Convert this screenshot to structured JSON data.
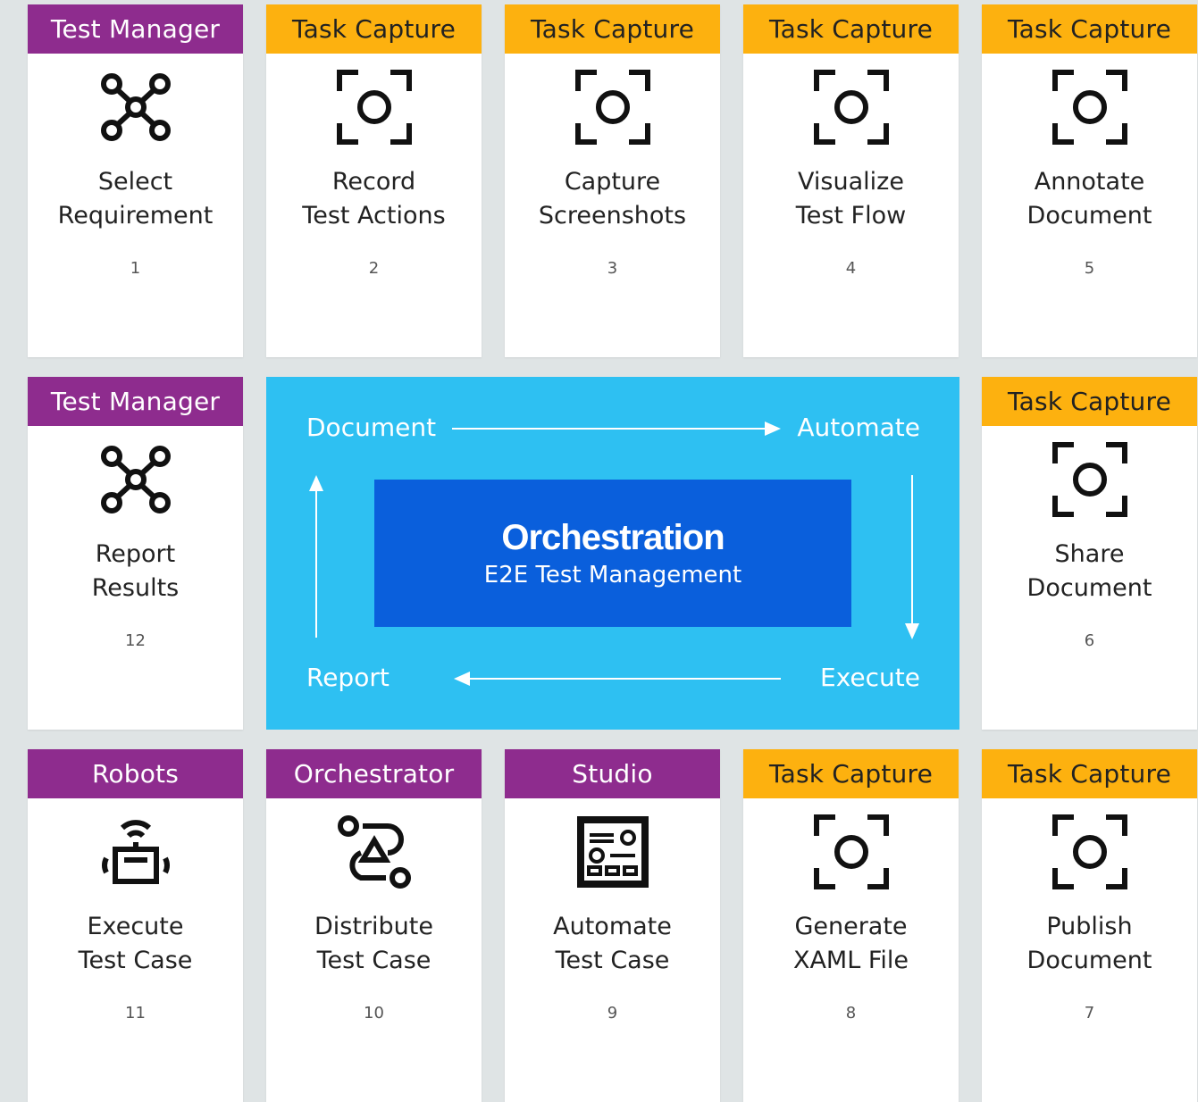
{
  "cards": [
    {
      "id": "select-requirement",
      "header": "Test Manager",
      "header_color": "#8e2c8e",
      "icon": "nodes-icon",
      "title": [
        "Select",
        "Requirement"
      ],
      "number": "1"
    },
    {
      "id": "record-test-actions",
      "header": "Task Capture",
      "header_color": "#fdb10f",
      "icon": "capture-icon",
      "title": [
        "Record",
        "Test Actions"
      ],
      "number": "2"
    },
    {
      "id": "capture-screenshots",
      "header": "Task Capture",
      "header_color": "#fdb10f",
      "icon": "capture-icon",
      "title": [
        "Capture",
        "Screenshots"
      ],
      "number": "3"
    },
    {
      "id": "visualize-test-flow",
      "header": "Task Capture",
      "header_color": "#fdb10f",
      "icon": "capture-icon",
      "title": [
        "Visualize",
        "Test Flow"
      ],
      "number": "4"
    },
    {
      "id": "annotate-document",
      "header": "Task Capture",
      "header_color": "#fdb10f",
      "icon": "capture-icon",
      "title": [
        "Annotate",
        "Document"
      ],
      "number": "5"
    },
    {
      "id": "share-document",
      "header": "Task Capture",
      "header_color": "#fdb10f",
      "icon": "capture-icon",
      "title": [
        "Share",
        "Document"
      ],
      "number": "6"
    },
    {
      "id": "publish-document",
      "header": "Task Capture",
      "header_color": "#fdb10f",
      "icon": "capture-icon",
      "title": [
        "Publish",
        "Document"
      ],
      "number": "7"
    },
    {
      "id": "generate-xaml-file",
      "header": "Task Capture",
      "header_color": "#fdb10f",
      "icon": "capture-icon",
      "title": [
        "Generate",
        "XAML File"
      ],
      "number": "8"
    },
    {
      "id": "automate-test-case",
      "header": "Studio",
      "header_color": "#8e2c8e",
      "icon": "studio-icon",
      "title": [
        "Automate",
        "Test Case"
      ],
      "number": "9"
    },
    {
      "id": "distribute-test-case",
      "header": "Orchestrator",
      "header_color": "#8e2c8e",
      "icon": "orchestrator-icon",
      "title": [
        "Distribute",
        "Test Case"
      ],
      "number": "10"
    },
    {
      "id": "execute-test-case",
      "header": "Robots",
      "header_color": "#8e2c8e",
      "icon": "robot-icon",
      "title": [
        "Execute",
        "Test Case"
      ],
      "number": "11"
    },
    {
      "id": "report-results",
      "header": "Test Manager",
      "header_color": "#8e2c8e",
      "icon": "nodes-icon",
      "title": [
        "Report",
        "Results"
      ],
      "number": "12"
    }
  ],
  "center": {
    "title": "Orchestration",
    "subtitle": "E2E Test Management",
    "flow": {
      "document": "Document",
      "automate": "Automate",
      "execute": "Execute",
      "report": "Report"
    },
    "background_color": "#2ec0f2",
    "box_color": "#0a5fdc"
  }
}
